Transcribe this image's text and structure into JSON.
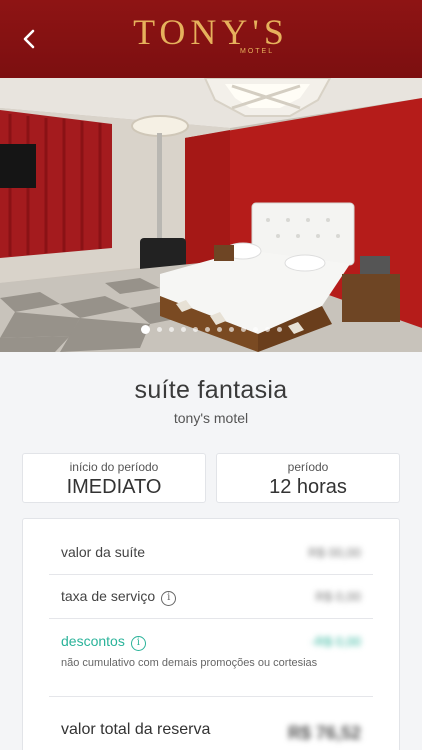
{
  "app": {
    "brand": "TONY'S",
    "brand_sub": "MOTEL"
  },
  "nav": {
    "back_icon": "chevron-left-icon"
  },
  "gallery": {
    "slide_count": 12,
    "active_index": 0
  },
  "suite": {
    "title": "suíte fantasia",
    "motel": "tony's motel"
  },
  "period": {
    "start_label": "início do período",
    "start_value": "IMEDIATO",
    "duration_label": "período",
    "duration_value": "12 horas"
  },
  "pricing": {
    "suite_label": "valor da suíte",
    "suite_value": "R$ 00,00",
    "service_label": "taxa de serviço",
    "service_value": "R$ 0,00",
    "discount_label": "descontos",
    "discount_value": "-R$ 0,00",
    "discount_note": "não cumulativo com demais promoções ou cortesias",
    "total_label": "valor total da reserva",
    "total_value": "R$ 76,52"
  },
  "colors": {
    "header": "#7c0f10",
    "brand_gold": "#e6b15c",
    "discount": "#2bb39a"
  }
}
